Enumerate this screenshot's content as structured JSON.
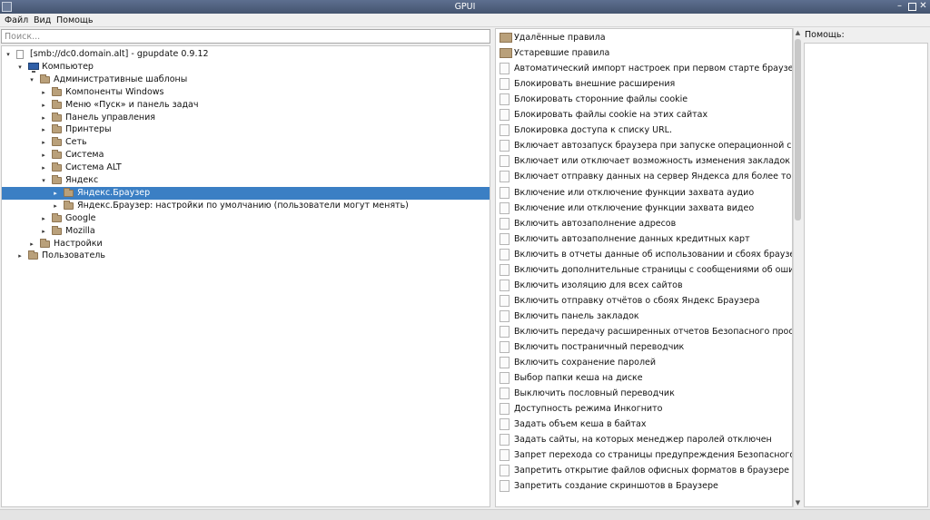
{
  "window": {
    "title": "GPUI"
  },
  "menu": {
    "file": "Файл",
    "view": "Вид",
    "help": "Помощь"
  },
  "search": {
    "placeholder": "Поиск..."
  },
  "tree": {
    "nodes": [
      {
        "label": "[smb://dc0.domain.alt] - gpupdate 0.9.12",
        "arrow": "▾",
        "icon": "document-icon"
      },
      {
        "label": "Компьютер",
        "arrow": "▾",
        "icon": "computer-icon"
      },
      {
        "label": "Административные шаблоны",
        "arrow": "▾",
        "icon": "folder-icon"
      },
      {
        "label": "Компоненты Windows",
        "arrow": "▸",
        "icon": "folder-icon"
      },
      {
        "label": "Меню «Пуск» и панель задач",
        "arrow": "▸",
        "icon": "folder-icon"
      },
      {
        "label": "Панель управления",
        "arrow": "▸",
        "icon": "folder-icon"
      },
      {
        "label": "Принтеры",
        "arrow": "▸",
        "icon": "folder-icon"
      },
      {
        "label": "Сеть",
        "arrow": "▸",
        "icon": "folder-icon"
      },
      {
        "label": "Система",
        "arrow": "▸",
        "icon": "folder-icon"
      },
      {
        "label": "Система ALT",
        "arrow": "▸",
        "icon": "folder-icon"
      },
      {
        "label": "Яндекс",
        "arrow": "▾",
        "icon": "folder-icon"
      },
      {
        "label": "Яндекс.Браузер",
        "arrow": "▸",
        "icon": "folder-icon",
        "selected": true
      },
      {
        "label": "Яндекс.Браузер: настройки по умолчанию (пользователи могут менять)",
        "arrow": "▸",
        "icon": "folder-icon"
      },
      {
        "label": "Google",
        "arrow": "▸",
        "icon": "folder-icon"
      },
      {
        "label": "Mozilla",
        "arrow": "▸",
        "icon": "folder-icon"
      },
      {
        "label": "Настройки",
        "arrow": "▸",
        "icon": "folder-icon"
      },
      {
        "label": "Пользователь",
        "arrow": "▸",
        "icon": "folder-icon"
      }
    ]
  },
  "policies": {
    "items": [
      {
        "label": "Удалённые правила",
        "icon": "folder-icon"
      },
      {
        "label": "Устаревшие правила",
        "icon": "folder-icon"
      },
      {
        "label": "Автоматический импорт настроек при первом старте браузера",
        "icon": "document-icon"
      },
      {
        "label": "Блокировать внешние расширения",
        "icon": "document-icon"
      },
      {
        "label": "Блокировать сторонние файлы cookie",
        "icon": "document-icon"
      },
      {
        "label": "Блокировать файлы cookie на этих сайтах",
        "icon": "document-icon"
      },
      {
        "label": "Блокировка доступа к списку URL.",
        "icon": "document-icon"
      },
      {
        "label": "Включает автозапуск браузера при запуске операционной системы.",
        "icon": "document-icon"
      },
      {
        "label": "Включает или отключает возможность изменения закладок",
        "icon": "document-icon"
      },
      {
        "label": "Включает отправку данных на сервер Яндекса для более точного опр",
        "icon": "document-icon"
      },
      {
        "label": "Включение или отключение функции захвата аудио",
        "icon": "document-icon"
      },
      {
        "label": "Включение или отключение функции захвата видео",
        "icon": "document-icon"
      },
      {
        "label": "Включить автозаполнение адресов",
        "icon": "document-icon"
      },
      {
        "label": "Включить автозаполнение данных кредитных карт",
        "icon": "document-icon"
      },
      {
        "label": "Включить в отчеты данные об использовании и сбоях браузера",
        "icon": "document-icon"
      },
      {
        "label": "Включить дополнительные страницы с сообщениями об ошибках",
        "icon": "document-icon"
      },
      {
        "label": "Включить изоляцию для всех сайтов",
        "icon": "document-icon"
      },
      {
        "label": "Включить отправку отчётов о сбоях Яндекс Браузера",
        "icon": "document-icon"
      },
      {
        "label": "Включить панель закладок",
        "icon": "document-icon"
      },
      {
        "label": "Включить передачу расширенных отчетов Безопасного просмотра",
        "icon": "document-icon"
      },
      {
        "label": "Включить постраничный переводчик",
        "icon": "document-icon"
      },
      {
        "label": "Включить сохранение паролей",
        "icon": "document-icon"
      },
      {
        "label": "Выбор папки кеша на диске",
        "icon": "document-icon"
      },
      {
        "label": "Выключить пословный переводчик",
        "icon": "document-icon"
      },
      {
        "label": "Доступность режима Инкогнито",
        "icon": "document-icon"
      },
      {
        "label": "Задать объем кеша в байтах",
        "icon": "document-icon"
      },
      {
        "label": "Задать сайты, на которых менеджер паролей отключен",
        "icon": "document-icon"
      },
      {
        "label": "Запрет перехода со страницы предупреждения Безопасного просмо",
        "icon": "document-icon"
      },
      {
        "label": "Запретить открытие файлов офисных форматов в браузере",
        "icon": "document-icon"
      },
      {
        "label": "Запретить создание скриншотов в Браузере",
        "icon": "document-icon"
      }
    ]
  },
  "help": {
    "label": "Помощь:"
  }
}
